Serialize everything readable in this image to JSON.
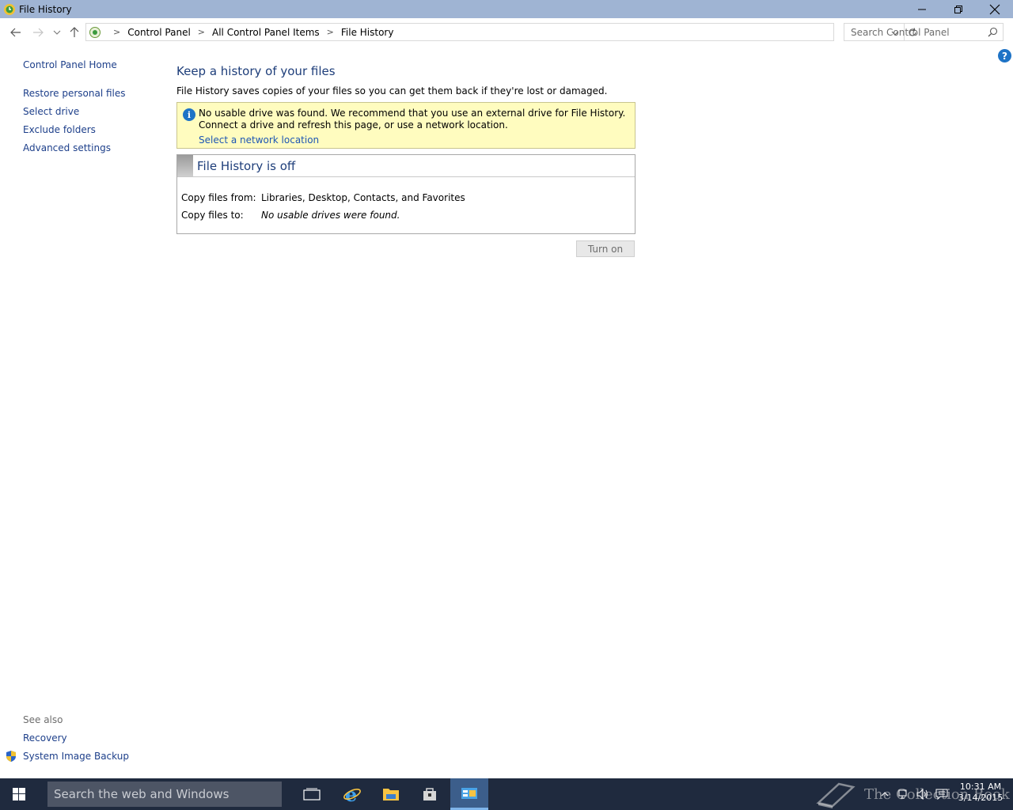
{
  "window": {
    "title": "File History"
  },
  "address": {
    "crumbs": [
      "Control Panel",
      "All Control Panel Items",
      "File History"
    ]
  },
  "search": {
    "placeholder": "Search Control Panel"
  },
  "sidebar": {
    "home": "Control Panel Home",
    "items": [
      "Restore personal files",
      "Select drive",
      "Exclude folders",
      "Advanced settings"
    ],
    "see_also_label": "See also",
    "see_also": [
      "Recovery",
      "System Image Backup"
    ]
  },
  "main": {
    "title": "Keep a history of your files",
    "description": "File History saves copies of your files so you can get them back if they're lost or damaged.",
    "warning": {
      "text": "No usable drive was found. We recommend that you use an external drive for File History. Connect a drive and refresh this page, or use a network location.",
      "link": "Select a network location"
    },
    "status": {
      "title": "File History is off",
      "rows": [
        {
          "label": "Copy files from:",
          "value": "Libraries, Desktop, Contacts, and Favorites"
        },
        {
          "label": "Copy files to:",
          "value": "No usable drives were found."
        }
      ]
    },
    "turn_on_label": "Turn on"
  },
  "taskbar": {
    "search_placeholder": "Search the web and Windows",
    "watermark": "The Collection Book",
    "time": "10:31 AM",
    "date": "3/14/2015"
  }
}
